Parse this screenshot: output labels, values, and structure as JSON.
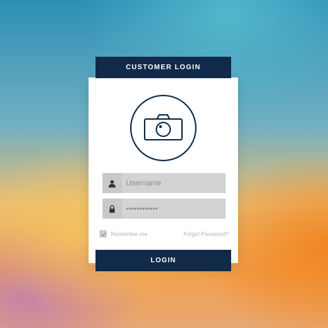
{
  "header": {
    "title": "CUSTOMER LOGIN"
  },
  "form": {
    "username": {
      "placeholder": "Username",
      "icon": "user-icon"
    },
    "password": {
      "placeholder": "••••••••••••",
      "icon": "lock-icon"
    },
    "remember_label": "Remember me",
    "forgot_label": "Forgot Password?",
    "submit_label": "LOGIN"
  },
  "avatar": {
    "icon": "camera-icon"
  },
  "colors": {
    "navy": "#112a4a",
    "field_bg": "#d3d3d3",
    "muted_text": "#b3b3b3"
  }
}
